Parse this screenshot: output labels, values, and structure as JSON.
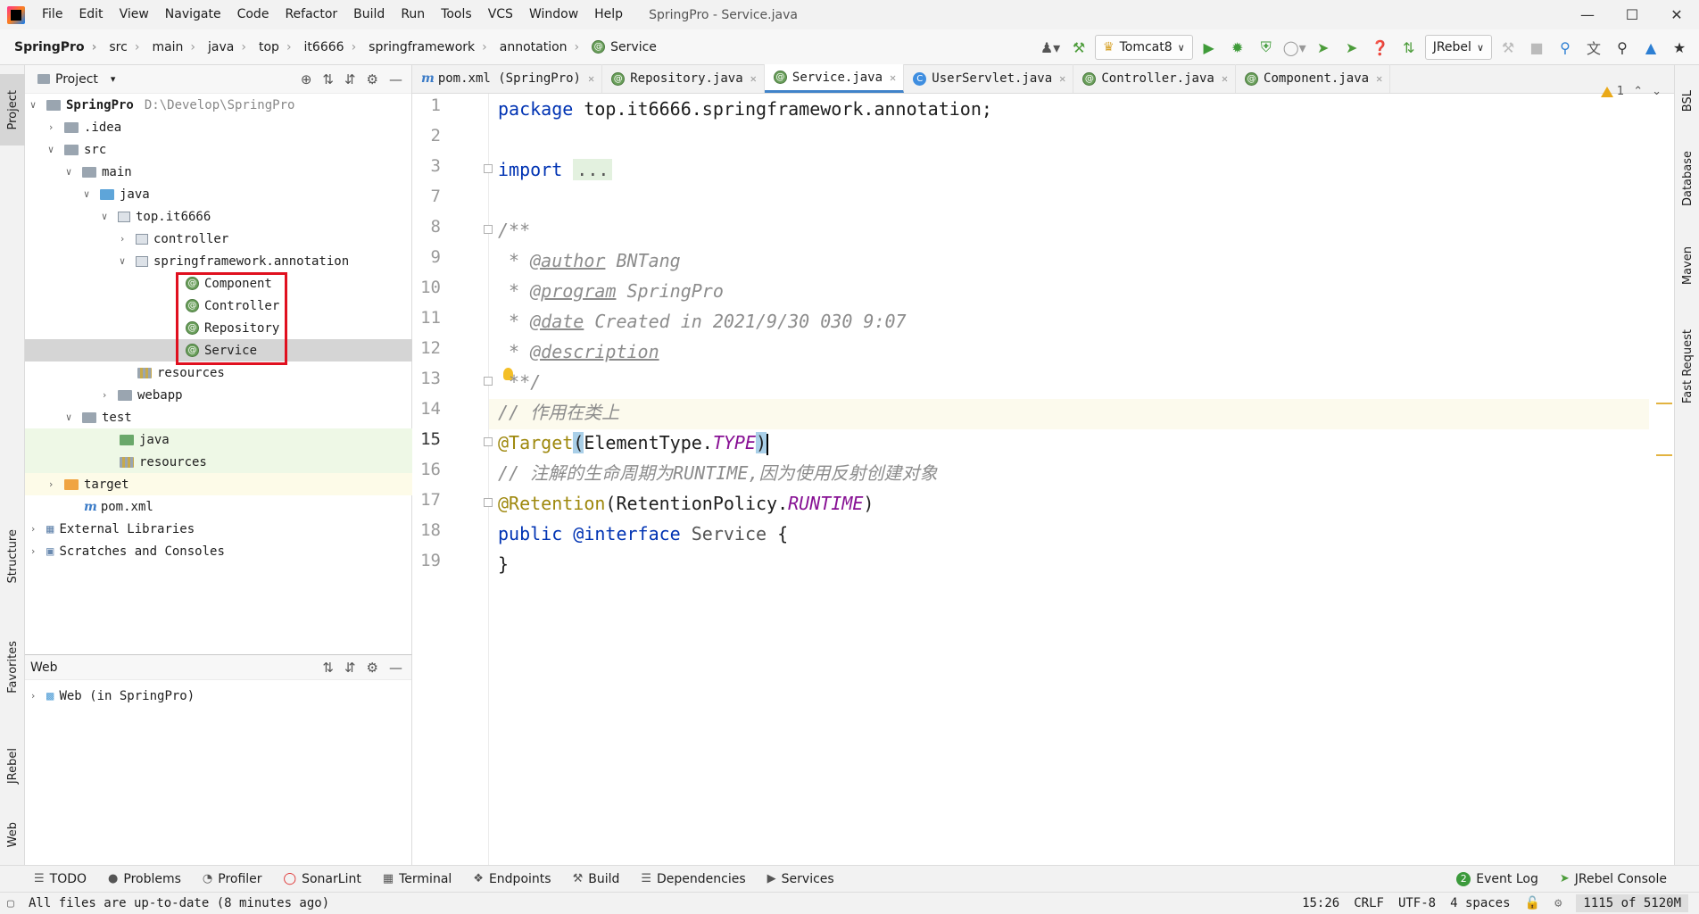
{
  "window": {
    "title": "SpringPro - Service.java",
    "menu": [
      "File",
      "Edit",
      "View",
      "Navigate",
      "Code",
      "Refactor",
      "Build",
      "Run",
      "Tools",
      "VCS",
      "Window",
      "Help"
    ]
  },
  "breadcrumb": [
    "SpringPro",
    "src",
    "main",
    "java",
    "top",
    "it6666",
    "springframework",
    "annotation",
    "Service"
  ],
  "toolbar": {
    "run_config": "Tomcat8",
    "jrebel": "JRebel"
  },
  "project_panel": {
    "title": "Project",
    "tree": [
      {
        "label": "SpringPro",
        "path": "D:\\Develop\\SpringPro"
      },
      {
        "label": ".idea"
      },
      {
        "label": "src"
      },
      {
        "label": "main"
      },
      {
        "label": "java"
      },
      {
        "label": "top.it6666"
      },
      {
        "label": "controller"
      },
      {
        "label": "springframework.annotation"
      },
      {
        "label": "Component"
      },
      {
        "label": "Controller"
      },
      {
        "label": "Repository"
      },
      {
        "label": "Service"
      },
      {
        "label": "resources"
      },
      {
        "label": "webapp"
      },
      {
        "label": "test"
      },
      {
        "label": "java"
      },
      {
        "label": "resources"
      },
      {
        "label": "target"
      },
      {
        "label": "pom.xml"
      },
      {
        "label": "External Libraries"
      },
      {
        "label": "Scratches and Consoles"
      }
    ]
  },
  "web_panel": {
    "title": "Web",
    "item": "Web (in SpringPro)"
  },
  "left_strip": [
    "Project",
    "Structure",
    "Favorites",
    "JRebel",
    "Web"
  ],
  "right_strip": [
    "BSL",
    "Database",
    "Maven",
    "Fast Request"
  ],
  "editor": {
    "tabs": [
      {
        "label": "pom.xml (SpringPro)"
      },
      {
        "label": "Repository.java"
      },
      {
        "label": "Service.java"
      },
      {
        "label": "UserServlet.java"
      },
      {
        "label": "Controller.java"
      },
      {
        "label": "Component.java"
      }
    ],
    "line_numbers": [
      "1",
      "2",
      "3",
      "7",
      "8",
      "9",
      "10",
      "11",
      "12",
      "13",
      "14",
      "15",
      "16",
      "17",
      "18",
      "19"
    ],
    "code": {
      "l1_kw": "package",
      "l1_rest": " top.it6666.springframework.annotation;",
      "l3_kw": "import",
      "l3_dots": "...",
      "l8": "/**",
      "l9_star": " * ",
      "l9_tag": "@author",
      "l9_text": " BNTang",
      "l10_tag": "@program",
      "l10_text": " SpringPro",
      "l11_tag": "@date",
      "l11_text": " Created in 2021/9/30 030 9:07",
      "l12_tag": "@description",
      "l13": " **/",
      "l14": "// 作用在类上",
      "l15_anno": "@Target",
      "l15_open": "(",
      "l15_cls": "ElementType.",
      "l15_const": "TYPE",
      "l15_close": ")",
      "l16": "// 注解的生命周期为RUNTIME,因为使用反射创建对象",
      "l17_anno": "@Retention",
      "l17_open": "(",
      "l17_cls": "RetentionPolicy.",
      "l17_const": "RUNTIME",
      "l17_close": ")",
      "l18_kw1": "public",
      "l18_kw2": "@interface",
      "l18_name": "Service",
      "l18_brace": "{",
      "l19": "}"
    },
    "inspection_count": "1"
  },
  "bottom_tabs": [
    "TODO",
    "Problems",
    "Profiler",
    "SonarLint",
    "Terminal",
    "Endpoints",
    "Build",
    "Dependencies",
    "Services"
  ],
  "bottom_right_tabs": [
    "Event Log",
    "JRebel Console"
  ],
  "event_log_count": "2",
  "status": {
    "message": "All files are up-to-date (8 minutes ago)",
    "position": "15:26",
    "line_sep": "CRLF",
    "encoding": "UTF-8",
    "indent": "4 spaces",
    "memory": "1115 of 5120M"
  }
}
